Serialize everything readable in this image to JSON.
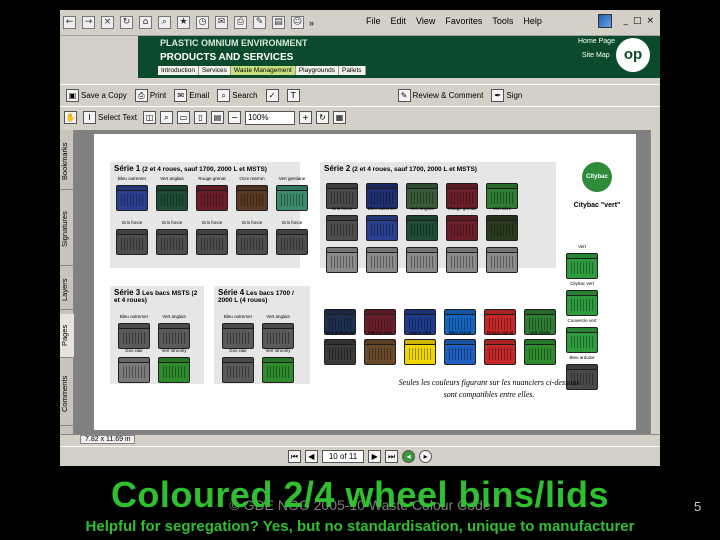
{
  "browser": {
    "menu": [
      "File",
      "Edit",
      "View",
      "Favorites",
      "Tools",
      "Help"
    ],
    "chevron": "»",
    "win_controls": [
      "_",
      "□",
      "×"
    ]
  },
  "site": {
    "company": "PLASTIC OMNIUM ENVIRONMENT",
    "section": "PRODUCTS AND SERVICES",
    "home_link": "Home Page",
    "sitemap_link": "Site Map",
    "logo": "op",
    "nav": [
      "Introduction",
      "Services",
      "Waste Management",
      "Playgrounds",
      "Pallets"
    ],
    "active_nav": "Waste Management"
  },
  "acrobat": {
    "save_copy": "Save a Copy",
    "print": "Print",
    "email": "Email",
    "search": "Search",
    "review": "Review & Comment",
    "sign": "Sign",
    "select_text": "Select Text",
    "zoom": "100%"
  },
  "sidetabs": [
    "Bookmarks",
    "Signatures",
    "Layers",
    "Pages",
    "Comments"
  ],
  "document": {
    "serie1": {
      "title": "Série 1",
      "desc": "(2 et 4 roues, sauf 1700, 2000 L et MSTS)"
    },
    "serie2": {
      "title": "Série 2",
      "desc": "(2 et 4 roues, sauf 1700, 2000 L et MSTS)"
    },
    "serie3": {
      "title": "Série 3",
      "desc": "Les bacs MSTS (2 et 4 roues)"
    },
    "serie4": {
      "title": "Série 4",
      "desc": "Les bacs 1700 / 2000 L (4 roues)"
    },
    "citybac": {
      "logo": "Citybac vert",
      "name": "Citybac \"vert\""
    },
    "caption_line1": "Seules les couleurs figurant sur les nuanciers ci-dessous",
    "caption_line2": "sont compatibles entre elles.",
    "s1_row1": [
      {
        "label": "Bleu outremer",
        "color": "#2a3f8f"
      },
      {
        "label": "Vert anglais",
        "color": "#1f4d34"
      },
      {
        "label": "Rouge grenat",
        "color": "#6b1e2a"
      },
      {
        "label": "Ocre marron",
        "color": "#5a3a22"
      },
      {
        "label": "Vert gentiane",
        "color": "#3a8a6c"
      }
    ],
    "s1_row2": [
      {
        "label": "Gris fonce",
        "color": "#4d4d4d"
      },
      {
        "label": "Gris fonce",
        "color": "#4d4d4d"
      },
      {
        "label": "Gris fonce",
        "color": "#4d4d4d"
      },
      {
        "label": "Gris fonce",
        "color": "#4d4d4d"
      },
      {
        "label": "Gris fonce",
        "color": "#4d4d4d"
      }
    ],
    "s2_row1": [
      {
        "label": "",
        "color": "#4a4a4a"
      },
      {
        "label": "",
        "color": "#1f2f6f"
      },
      {
        "label": "",
        "color": "#3a5a3a"
      },
      {
        "label": "",
        "color": "#6b1e2a"
      },
      {
        "label": "",
        "color": "#2e7d32"
      }
    ],
    "s2_row2": [
      {
        "label": "Gris fonce",
        "color": "#4d4d4d"
      },
      {
        "label": "Bleu outremer",
        "color": "#2a3f8f"
      },
      {
        "label": "Vert anglais",
        "color": "#1f4d34"
      },
      {
        "label": "Rouge grenat",
        "color": "#6b1e2a"
      },
      {
        "label": "Vert olive",
        "color": "#2a3a1f"
      }
    ],
    "s2_row3": [
      {
        "label": "",
        "color": "#8a8a8a"
      },
      {
        "label": "",
        "color": "#8a8a8a"
      },
      {
        "label": "",
        "color": "#8a8a8a"
      },
      {
        "label": "",
        "color": "#8a8a8a"
      },
      {
        "label": "",
        "color": "#8a8a8a"
      }
    ],
    "s3_row1": [
      {
        "label": "Bleu outremer",
        "color": "#5a5a5a"
      },
      {
        "label": "Vert anglais",
        "color": "#5a5a5a"
      }
    ],
    "s3_row2": [
      {
        "label": "Gris clair",
        "color": "#7a7a7a"
      },
      {
        "label": "Vert stroonly",
        "color": "#2e8b2e"
      }
    ],
    "s4_row1": [
      {
        "label": "Bleu outremer",
        "color": "#5a5a5a"
      },
      {
        "label": "Vert anglais",
        "color": "#5a5a5a"
      }
    ],
    "s4_row2": [
      {
        "label": "Gris clair",
        "color": "#5a5a5a"
      },
      {
        "label": "Vert stroonly",
        "color": "#2e8b2e"
      }
    ],
    "s2_low1": [
      {
        "label": "",
        "color": "#1f2f4f"
      },
      {
        "label": "",
        "color": "#6b1e2a"
      },
      {
        "label": "",
        "color": "#1e3a8a"
      },
      {
        "label": "",
        "color": "#1565c0"
      },
      {
        "label": "",
        "color": "#c62828"
      },
      {
        "label": "",
        "color": "#2e7d32"
      }
    ],
    "s2_low2": [
      {
        "label": "Vert anthracite",
        "color": "#3a3a3a"
      },
      {
        "label": "Marron pale",
        "color": "#6b4a2a"
      },
      {
        "label": "Jaune citre",
        "color": "#f2d600"
      },
      {
        "label": "Bleu signal",
        "color": "#1f5fc0"
      },
      {
        "label": "Rouge signal",
        "color": "#c62828"
      },
      {
        "label": "Vert sibirie",
        "color": "#2e8b2e"
      }
    ],
    "city_bins": [
      {
        "label": "Vert",
        "color": "#2e9b3e"
      },
      {
        "label": "Citybac vert",
        "color": "#2e9b3e"
      },
      {
        "label": "Couvercle vert",
        "color": "#2e9b3e"
      },
      {
        "label": "Bleu ardoise",
        "color": "#4a4a4a"
      }
    ]
  },
  "status": {
    "dimensions": "7.82 x 11.69 in"
  },
  "pager": {
    "page": "10 of 11"
  },
  "slide": {
    "title": "Coloured 2/4 wheel bins/lids",
    "copyright": "© GDE NGO 2005-10 Waste Colour Code",
    "number": "5",
    "subtitle": "Helpful for segregation? Yes, but no standardisation, unique to manufacturer",
    "title_color": "#2fbf2f"
  }
}
